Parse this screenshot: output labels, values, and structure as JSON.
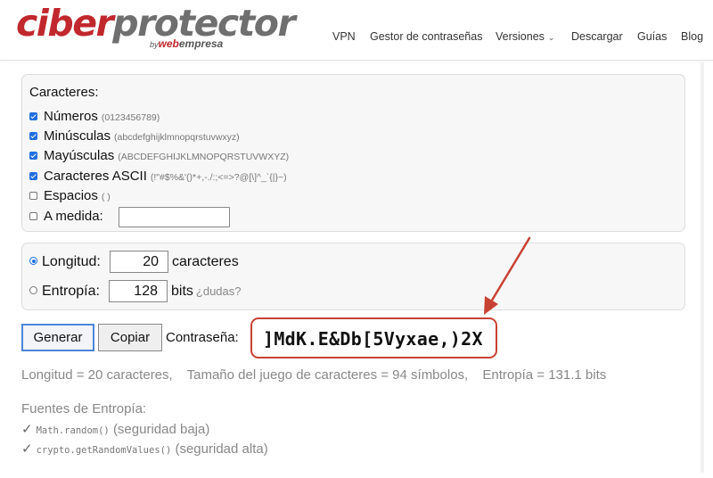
{
  "header": {
    "logo": {
      "ciber": "ciber",
      "protector": "protector",
      "by": "by",
      "web": "web",
      "empresa": "empresa"
    },
    "nav": [
      {
        "label": "VPN"
      },
      {
        "label": "Gestor de contraseñas"
      },
      {
        "label": "Versiones",
        "icon": "chevron-down-icon"
      },
      {
        "label": "Descargar"
      },
      {
        "label": "Guías"
      },
      {
        "label": "Blog"
      }
    ]
  },
  "characters": {
    "title": "Caracteres:",
    "options": [
      {
        "label": "Números",
        "hint": "(0123456789)",
        "checked": true
      },
      {
        "label": "Minúsculas",
        "hint": "(abcdefghijklmnopqrstuvwxyz)",
        "checked": true
      },
      {
        "label": "Mayúsculas",
        "hint": "(ABCDEFGHIJKLMNOPQRSTUVWXYZ)",
        "checked": true
      },
      {
        "label": "Caracteres ASCII",
        "hint": "(!\"#$%&'()*+,-./:;<=>?@[\\]^_`{|}~)",
        "checked": true
      },
      {
        "label": "Espacios",
        "hint": "( )",
        "checked": false
      },
      {
        "label": "A medida:",
        "checked": false,
        "value": ""
      }
    ]
  },
  "length": {
    "longitud_label": "Longitud:",
    "longitud_value": "20",
    "longitud_unit": "caracteres",
    "longitud_selected": true,
    "entropia_label": "Entropía:",
    "entropia_value": "128",
    "entropia_unit": "bits",
    "entropia_help": "¿dudas?",
    "entropia_selected": false
  },
  "actions": {
    "generate_label": "Generar",
    "copy_label": "Copiar",
    "password_label": "Contraseña:",
    "password": "]MdK.E&Db[5Vyxae,)2X"
  },
  "stats": {
    "length": "Longitud = 20 caracteres,",
    "charset": "Tamaño del juego de caracteres = 94 símbolos,",
    "entropy": "Entropía = 131.1 bits"
  },
  "sources": {
    "title": "Fuentes de Entropía:",
    "items": [
      {
        "check": "✓",
        "code": "Math.random()",
        "text": "(seguridad baja)"
      },
      {
        "check": "✓",
        "code": "crypto.getRandomValues()",
        "text": "(seguridad alta)"
      }
    ]
  },
  "colors": {
    "brand_red": "#c0282d",
    "highlight_red": "#c84233",
    "accent_blue": "#1f6fe0"
  }
}
